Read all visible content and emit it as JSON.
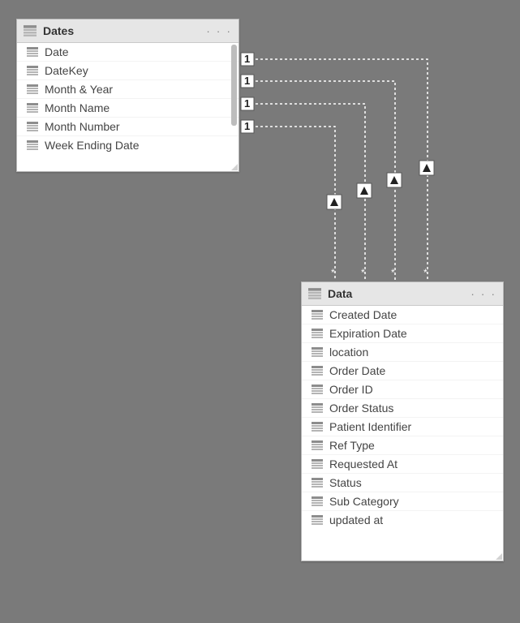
{
  "tables": {
    "dates": {
      "title": "Dates",
      "fields": [
        "Date",
        "DateKey",
        "Month & Year",
        "Month Name",
        "Month Number",
        "Week Ending Date"
      ]
    },
    "data": {
      "title": "Data",
      "fields": [
        "Created Date",
        "Expiration Date",
        "location",
        "Order Date",
        "Order ID",
        "Order Status",
        "Patient Identifier",
        "Ref Type",
        "Requested At",
        "Status",
        "Sub Category",
        "updated at"
      ]
    }
  },
  "relationships": {
    "from_card": "dates",
    "to_card": "data",
    "cardinality_from": "1",
    "cardinality_to": "*",
    "count": 4
  },
  "glyphs": {
    "menu_dots": "· · ·"
  }
}
